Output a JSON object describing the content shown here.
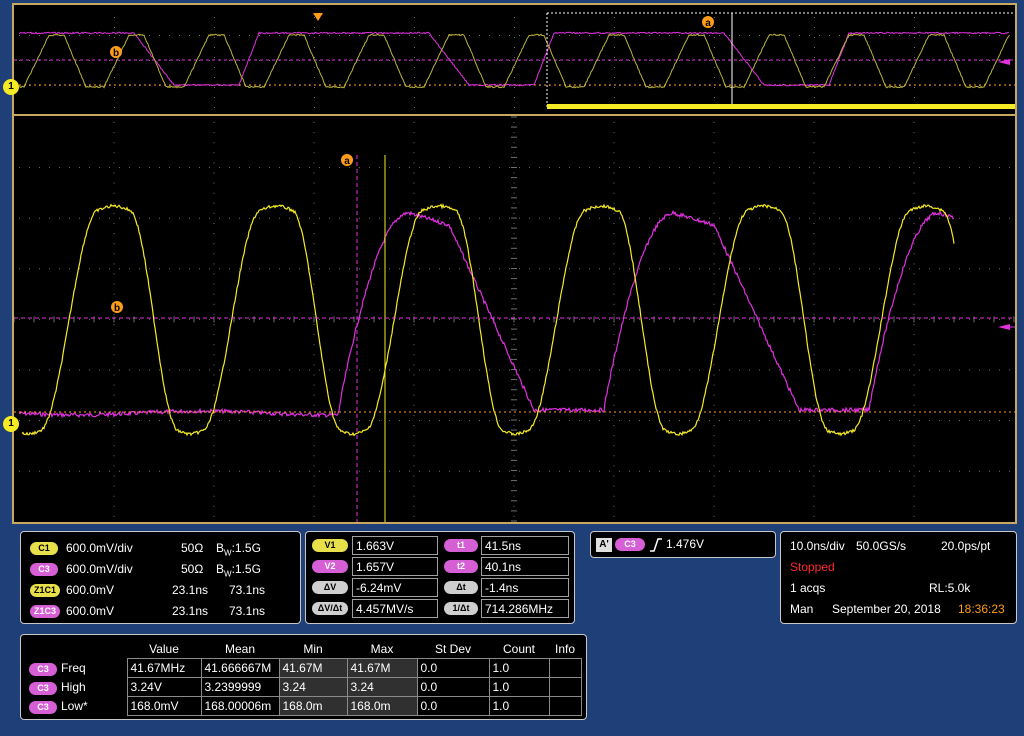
{
  "colors": {
    "ch1": "#f5eb24",
    "ch3": "#e030e0",
    "cursor": "#ff9c1a",
    "grid": "#6f6f6f",
    "frame": "#c8a860",
    "background": "#1f3f78"
  },
  "scope": {
    "ch1_level_marker": "1",
    "cursor_a_label": "a",
    "cursor_b_label": "b"
  },
  "channels": {
    "rows": [
      {
        "badge": "C1",
        "scale": "600.0mV/div",
        "impedance": "50Ω",
        "bw_prefix": "B",
        "bw_sub": "W",
        "bw_value": ":1.5G",
        "t1": "",
        "t2": ""
      },
      {
        "badge": "C3",
        "scale": "600.0mV/div",
        "impedance": "50Ω",
        "bw_prefix": "B",
        "bw_sub": "W",
        "bw_value": ":1.5G",
        "t1": "",
        "t2": ""
      },
      {
        "badge": "Z1C1",
        "scale": "600.0mV",
        "impedance": "",
        "bw_prefix": "",
        "bw_sub": "",
        "bw_value": "",
        "t1": "23.1ns",
        "t2": "73.1ns"
      },
      {
        "badge": "Z1C3",
        "scale": "600.0mV",
        "impedance": "",
        "bw_prefix": "",
        "bw_sub": "",
        "bw_value": "",
        "t1": "23.1ns",
        "t2": "73.1ns"
      }
    ]
  },
  "cursors": {
    "v1_label": "V1",
    "v1": "1.663V",
    "v2_label": "V2",
    "v2": "1.657V",
    "dv_label": "ΔV",
    "dv": "-6.24mV",
    "dvdt_label": "ΔV/Δt",
    "dvdt": "4.457MV/s",
    "t1_label": "t1",
    "t1": "41.5ns",
    "t2_label": "t2",
    "t2": "40.1ns",
    "dt_label": "Δt",
    "dt": "-1.4ns",
    "inv_dt_label": "1/Δt",
    "inv_dt": "714.286MHz"
  },
  "trigger": {
    "source_badge": "A'",
    "channel_badge": "C3",
    "level": "1.476V"
  },
  "acquisition": {
    "timebase": "10.0ns/div",
    "sample_rate": "50.0GS/s",
    "resolution": "20.0ps/pt",
    "status": "Stopped",
    "acqs": "1 acqs",
    "record_length": "RL:5.0k",
    "mode": "Man",
    "date": "September 20, 2018",
    "time": "18:36:23"
  },
  "measurements": {
    "headers": [
      "Value",
      "Mean",
      "Min",
      "Max",
      "St Dev",
      "Count",
      "Info"
    ],
    "rows": [
      {
        "badge": "C3",
        "name": "Freq",
        "value": "41.67MHz",
        "mean": "41.666667M",
        "min": "41.67M",
        "max": "41.67M",
        "stdev": "0.0",
        "count": "1.0",
        "info": ""
      },
      {
        "badge": "C3",
        "name": "High",
        "value": "3.24V",
        "mean": "3.2399999",
        "min": "3.24",
        "max": "3.24",
        "stdev": "0.0",
        "count": "1.0",
        "info": ""
      },
      {
        "badge": "C3",
        "name": "Low*",
        "value": "168.0mV",
        "mean": "168.00006m",
        "min": "168.0m",
        "max": "168.0m",
        "stdev": "0.0",
        "count": "1.0",
        "info": ""
      }
    ]
  }
}
